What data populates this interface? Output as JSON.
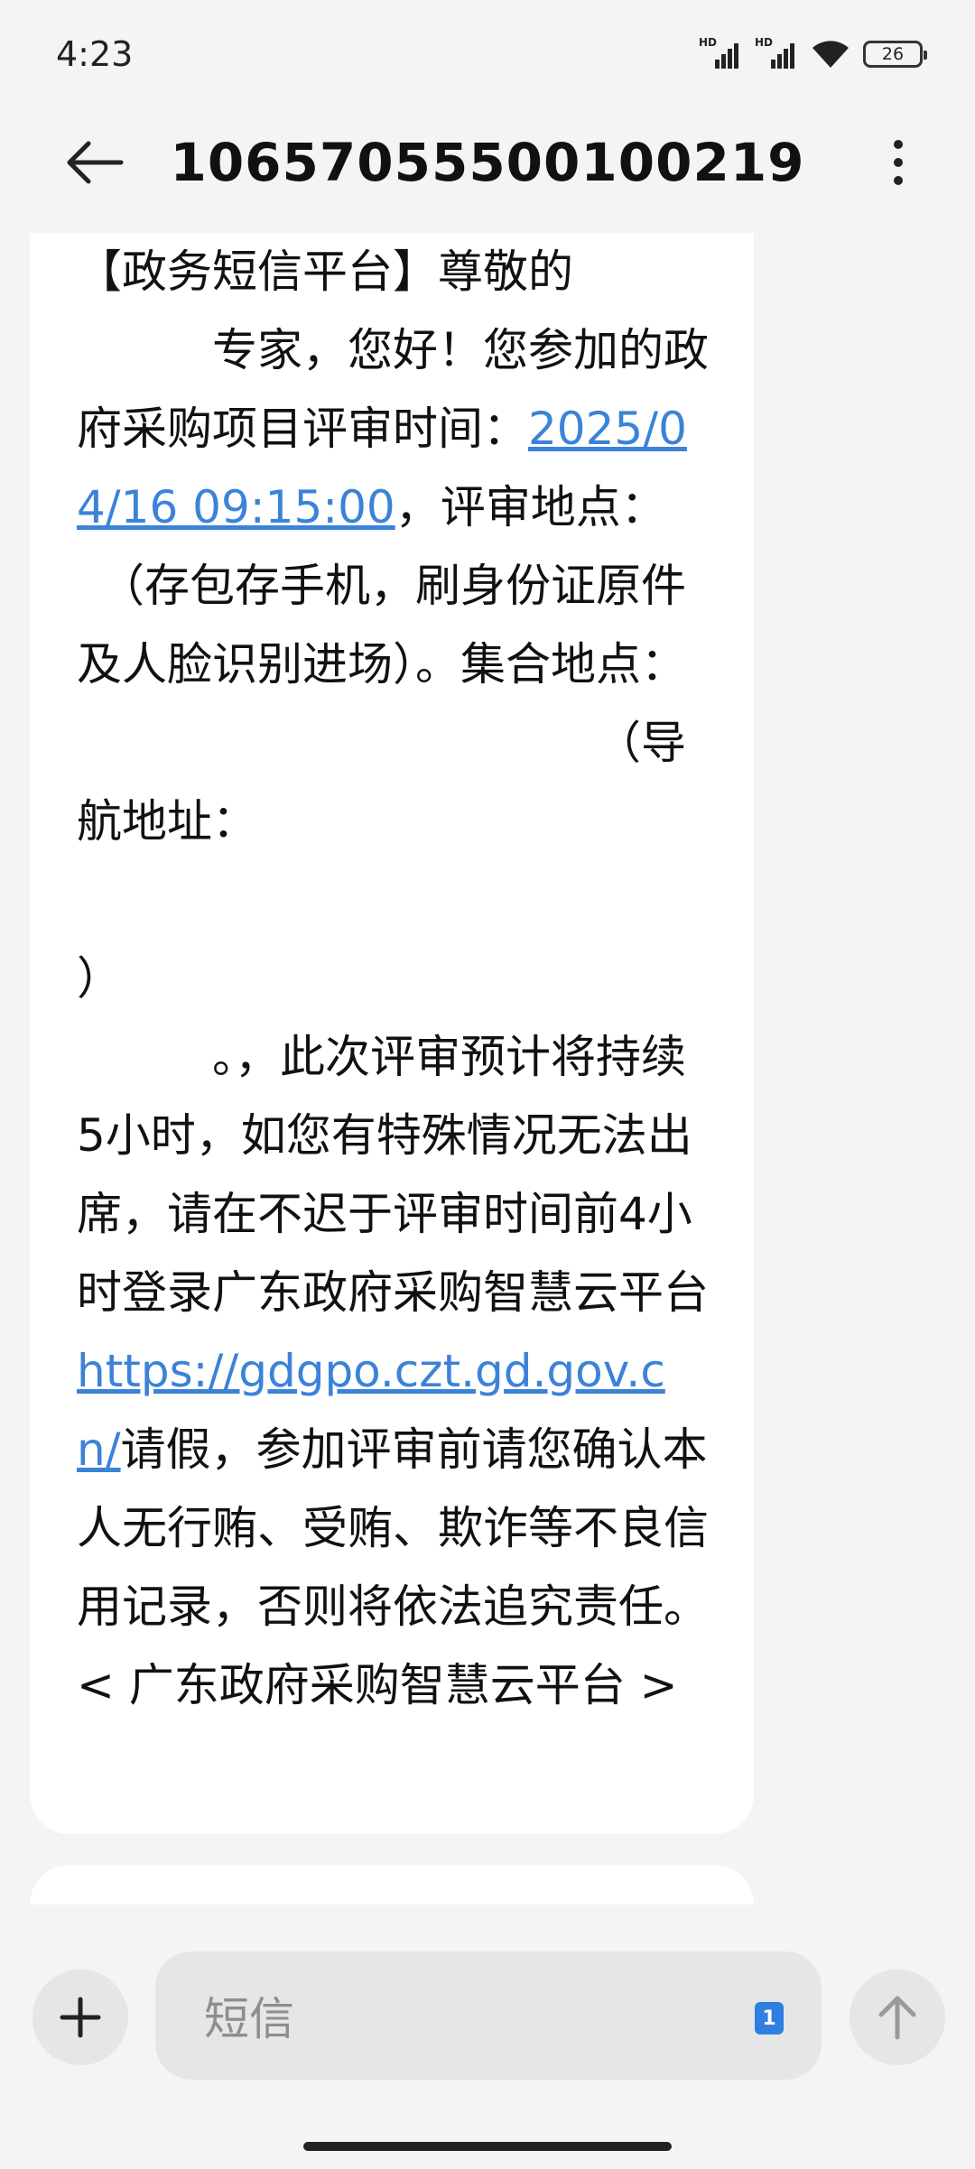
{
  "status_bar": {
    "time": "4:23",
    "sim1_label": "HD",
    "sim2_label": "HD",
    "battery": "26",
    "icons": [
      "signal-icon",
      "signal-icon",
      "wifi-icon",
      "battery-icon"
    ]
  },
  "header": {
    "title": "10657055500100219",
    "back_icon": "back-arrow-icon",
    "more_icon": "more-vertical-icon"
  },
  "message": {
    "segments": [
      {
        "type": "text",
        "value": "【政务短信平台】尊敬的\n　　　专家，您好！您参加的政府采购项目评审时间："
      },
      {
        "type": "link",
        "value": "2025/04/16 09:15:00"
      },
      {
        "type": "text",
        "value": "，评审地点：\n　（存包存手机，刷身份证原件及人脸识别进场）。集合地点：\n　　　　　　　　　　　　（导航地址：\n　　　　　　　　　　　　　　　　）\n　　　。，此次评审预计将持续5小时，如您有特殊情况无法出席，请在不迟于评审时间前4小时登录广东政府采购智慧云平台"
      },
      {
        "type": "link",
        "value": "https://gdgpo.czt.gd.gov.cn/"
      },
      {
        "type": "text",
        "value": "请假，参加评审前请您确认本人无行贿、受贿、欺诈等不良信用记录，否则将依法追究责任。< 广东政府采购智慧云平台 >"
      }
    ]
  },
  "input_bar": {
    "placeholder": "短信",
    "sim_badge": "1",
    "add_icon": "plus-icon",
    "send_icon": "send-arrow-up-icon"
  },
  "colors": {
    "link": "#3b82d9",
    "background": "#f4f4f4",
    "bubble": "#ffffff",
    "sim_badge": "#2f7fe0"
  }
}
